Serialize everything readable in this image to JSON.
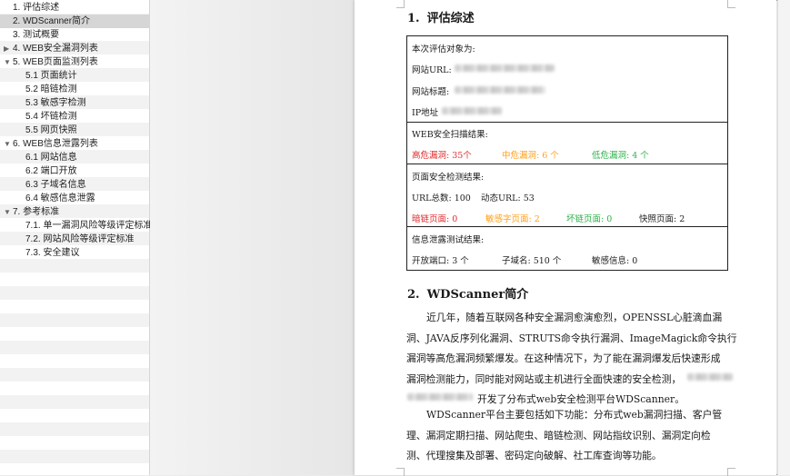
{
  "toc": {
    "items": [
      {
        "label": "1. 评估综述",
        "indent": 0,
        "tri": "",
        "selected": false
      },
      {
        "label": "2. WDScanner简介",
        "indent": 0,
        "tri": "",
        "selected": true
      },
      {
        "label": "3. 测试概要",
        "indent": 0,
        "tri": "",
        "selected": false
      },
      {
        "label": "4. WEB安全漏洞列表",
        "indent": 0,
        "tri": "▶",
        "selected": false
      },
      {
        "label": "5. WEB页面监测列表",
        "indent": 0,
        "tri": "▼",
        "selected": false
      },
      {
        "label": "5.1 页面统计",
        "indent": 1,
        "tri": "",
        "selected": false
      },
      {
        "label": "5.2 暗链检测",
        "indent": 1,
        "tri": "",
        "selected": false
      },
      {
        "label": "5.3 敏感字检测",
        "indent": 1,
        "tri": "",
        "selected": false
      },
      {
        "label": "5.4 坏链检测",
        "indent": 1,
        "tri": "",
        "selected": false
      },
      {
        "label": "5.5 网页快照",
        "indent": 1,
        "tri": "",
        "selected": false
      },
      {
        "label": "6. WEB信息泄露列表",
        "indent": 0,
        "tri": "▼",
        "selected": false
      },
      {
        "label": "6.1 网站信息",
        "indent": 1,
        "tri": "",
        "selected": false
      },
      {
        "label": "6.2 端口开放",
        "indent": 1,
        "tri": "",
        "selected": false
      },
      {
        "label": "6.3 子域名信息",
        "indent": 1,
        "tri": "",
        "selected": false
      },
      {
        "label": "6.4 敏感信息泄露",
        "indent": 1,
        "tri": "",
        "selected": false
      },
      {
        "label": "7. 参考标准",
        "indent": 0,
        "tri": "▼",
        "selected": false
      },
      {
        "label": "7.1. 单一漏洞风险等级评定标准",
        "indent": 1,
        "tri": "",
        "selected": false
      },
      {
        "label": "7.2. 网站风险等级评定标准",
        "indent": 1,
        "tri": "",
        "selected": false
      },
      {
        "label": "7.3. 安全建议",
        "indent": 1,
        "tri": "",
        "selected": false
      }
    ]
  },
  "section1": {
    "num": "1.",
    "title": "评估综述",
    "target_label": "本次评估对象为:",
    "url_label": "网站URL:",
    "title_label": "网站标题:",
    "ip_label": "IP地址",
    "scan_label": "WEB安全扫描结果:",
    "high": "高危漏洞: 35个",
    "mid": "中危漏洞: 6 个",
    "low": "低危漏洞: 4 个",
    "page_label": "页面安全检测结果:",
    "url_total": "URL总数: 100",
    "url_dynamic": "动态URL: 53",
    "dark_pages": "暗链页面: 0",
    "sens_pages": "敏感字页面: 2",
    "broken_pages": "坏链页面: 0",
    "snap_pages": "快照页面: 2",
    "leak_label": "信息泄露测试结果:",
    "ports": "开放端口: 3 个",
    "subdomains": "子域名: 510 个",
    "sensitive": "敏感信息: 0"
  },
  "section2": {
    "num": "2.",
    "title": "WDScanner简介",
    "p1": [
      "近几年，随着互联网各种安全漏洞愈演愈烈，OPENSSL心脏滴血漏",
      "洞、JAVA反序列化漏洞、STRUTS命令执行漏洞、ImageMagick命令执行",
      "漏洞等高危漏洞频繁爆发。在这种情况下，为了能在漏洞爆发后快速形成",
      "漏洞检测能力，同时能对网站或主机进行全面快速的安全检测，",
      "开发了分布式web安全检测平台WDScanner。"
    ],
    "p2": [
      "WDScanner平台主要包括如下功能：分布式web漏洞扫描、客户管",
      "理、漏洞定期扫描、网站爬虫、暗链检测、网站指纹识别、漏洞定向检",
      "测、代理搜集及部署、密码定向破解、社工库查询等功能。"
    ]
  },
  "colors": {
    "high": "#e02b2b",
    "mid": "#ff9f1a",
    "low": "#2eb24a"
  }
}
